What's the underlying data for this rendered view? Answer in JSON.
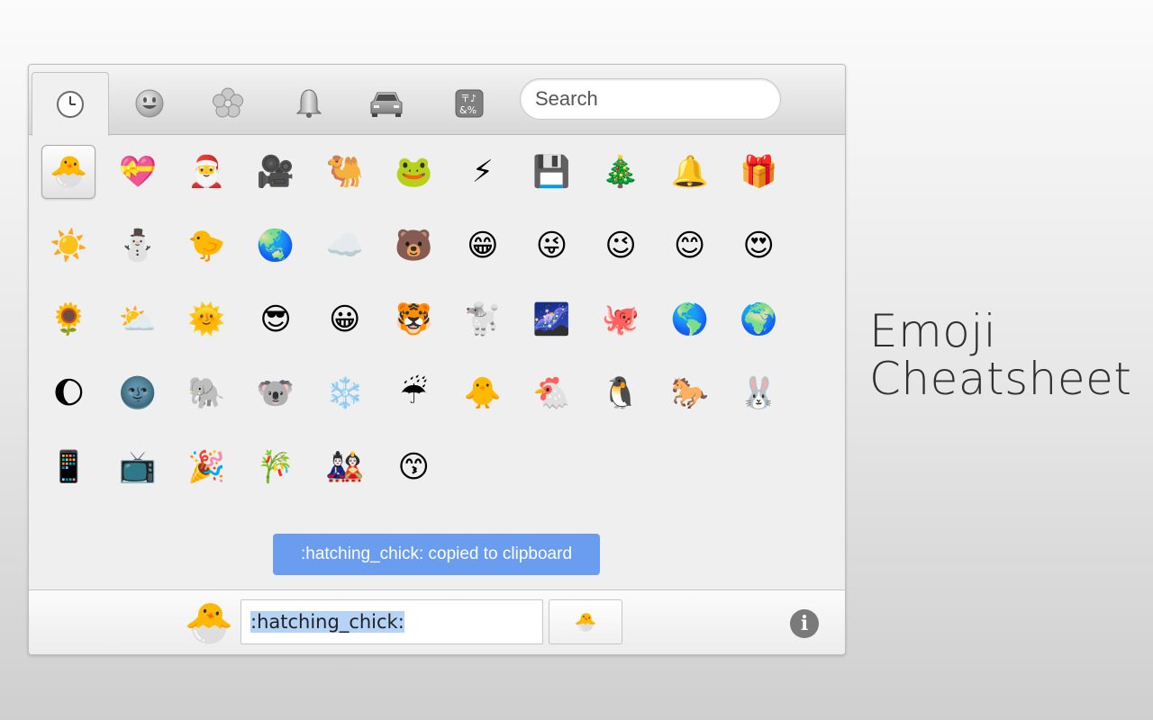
{
  "tabs": [
    {
      "name": "recent",
      "icon": "clock-icon"
    },
    {
      "name": "people",
      "icon": "smiley-icon"
    },
    {
      "name": "nature",
      "icon": "flower-icon"
    },
    {
      "name": "objects",
      "icon": "bell-icon"
    },
    {
      "name": "places",
      "icon": "car-icon"
    },
    {
      "name": "symbols",
      "icon": "symbols-icon"
    }
  ],
  "search": {
    "placeholder": "Search"
  },
  "emojis": [
    "🐣",
    "💝",
    "🎅",
    "🎥",
    "🐫",
    "🐸",
    "⚡",
    "💾",
    "🎄",
    "🔔",
    "🎁",
    "☀️",
    "⛄",
    "🐤",
    "🌏",
    "☁️",
    "🐻",
    "😁",
    "😜",
    "😉",
    "😊",
    "😍",
    "🌻",
    "⛅",
    "🌞",
    "😎",
    "😀",
    "🐯",
    "🐩",
    "🌌",
    "🐙",
    "🌎",
    "🌍",
    "🌔",
    "🌚",
    "🐘",
    "🐨",
    "❄️",
    "☔",
    "🐥",
    "🐔",
    "🐧",
    "🐎",
    "🐰",
    "📱",
    "📺",
    "🎉",
    "🎋",
    "🎎",
    "😙"
  ],
  "selected_index": 0,
  "toast": {
    "text": ":hatching_chick: copied to clipboard"
  },
  "bottom": {
    "preview_emoji": "🐣",
    "code_value": ":hatching_chick:",
    "copy_emoji": "🐣",
    "info_label": "i"
  },
  "headline": {
    "line1": "Emoji",
    "line2": "Cheatsheet"
  }
}
